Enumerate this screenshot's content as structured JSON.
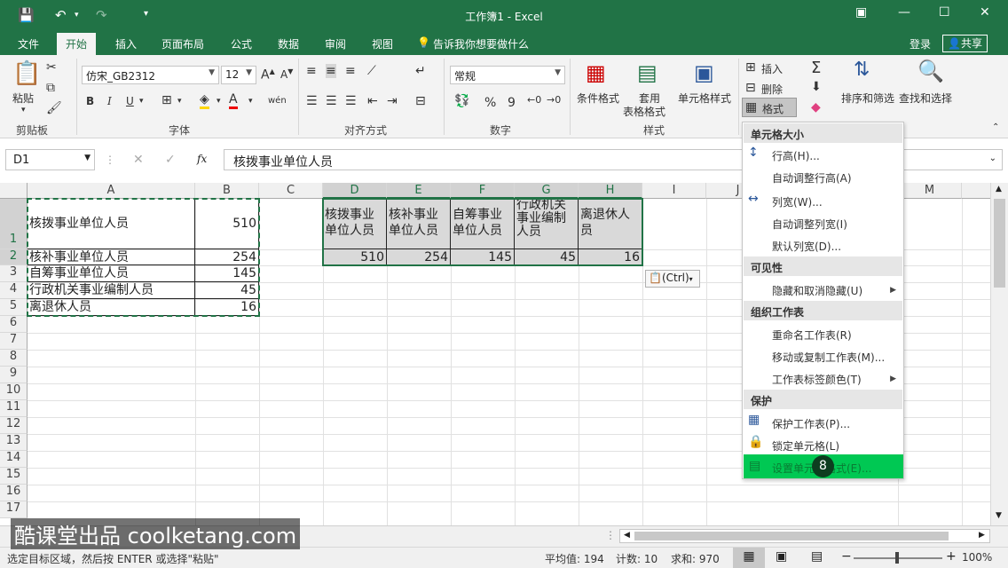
{
  "window": {
    "title": "工作簿1 - Excel",
    "qa_save": "💾",
    "qa_undo": "↶",
    "qa_redo": "↷",
    "qa_more": "▾",
    "btn_ribbon_opts": "▣",
    "btn_min": "—",
    "btn_max": "☐",
    "btn_close": "✕"
  },
  "tabs": [
    "文件",
    "开始",
    "插入",
    "页面布局",
    "公式",
    "数据",
    "审阅",
    "视图"
  ],
  "tell_me": "告诉我你想要做什么",
  "login": "登录",
  "share": "共享",
  "ribbon": {
    "paste": "粘贴",
    "font_name": "仿宋_GB2312",
    "font_size": "12",
    "bold": "B",
    "italic": "I",
    "underline": "U",
    "phonetic": "wén",
    "number_format": "常规",
    "percent": "%",
    "comma": "9",
    "cond_format": "条件格式",
    "table_format_1": "套用",
    "table_format_2": "表格格式",
    "cell_style": "单元格样式",
    "insert": "插入",
    "delete": "删除",
    "format": "格式",
    "sort_filter": "排序和筛选",
    "find_select": "查找和选择",
    "groups": {
      "clipboard": "剪贴板",
      "font": "字体",
      "align": "对齐方式",
      "number": "数字",
      "styles": "样式"
    }
  },
  "formula_bar": {
    "name_box": "D1",
    "cancel": "✕",
    "enter": "✓",
    "fx": "fx",
    "content": "核拨事业单位人员"
  },
  "columns": [
    "A",
    "B",
    "C",
    "D",
    "E",
    "F",
    "G",
    "H",
    "I",
    "J",
    "M"
  ],
  "rows": [
    "1",
    "2",
    "3",
    "4",
    "5",
    "6",
    "7",
    "8",
    "9",
    "10",
    "11",
    "12",
    "13",
    "14",
    "15",
    "16",
    "17"
  ],
  "cells": {
    "a1": "核拨事业单位人员",
    "b1": "510",
    "a2": "核补事业单位人员",
    "b2": "254",
    "a3": "自筹事业单位人员",
    "b3": "145",
    "a4": "行政机关事业编制人员",
    "b4": "45",
    "a5": "离退休人员",
    "b5": "16",
    "d1": "核拨事业单位人员",
    "e1": "核补事业单位人员",
    "f1": "自筹事业单位人员",
    "g1": "行政机关事业编制人员",
    "h1": "离退休人员",
    "d2": "510",
    "e2": "254",
    "f2": "145",
    "g2": "45",
    "h2": "16"
  },
  "paste_ctrl": "(Ctrl)",
  "menu": {
    "sec_size": "单元格大小",
    "row_height": "行高(H)...",
    "autofit_row": "自动调整行高(A)",
    "col_width": "列宽(W)...",
    "autofit_col": "自动调整列宽(I)",
    "default_width": "默认列宽(D)...",
    "sec_visibility": "可见性",
    "hide_unhide": "隐藏和取消隐藏(U)",
    "sec_organize": "组织工作表",
    "rename": "重命名工作表(R)",
    "move_copy": "移动或复制工作表(M)...",
    "tab_color": "工作表标签颜色(T)",
    "sec_protect": "保护",
    "protect_sheet": "保护工作表(P)...",
    "lock_cell": "锁定单元格(L)",
    "format_cells": "设置单元格格式(E)...",
    "step_badge": "8"
  },
  "status": {
    "hint": "选定目标区域，然后按 ENTER 或选择\"粘贴\"",
    "average": "平均值: 194",
    "count": "计数: 10",
    "sum": "求和: 970",
    "zoom": "100%"
  },
  "watermark": "酷课堂出品 coolketang.com",
  "colors": {
    "excel_green": "#217346",
    "highlight_green": "#00c853"
  }
}
